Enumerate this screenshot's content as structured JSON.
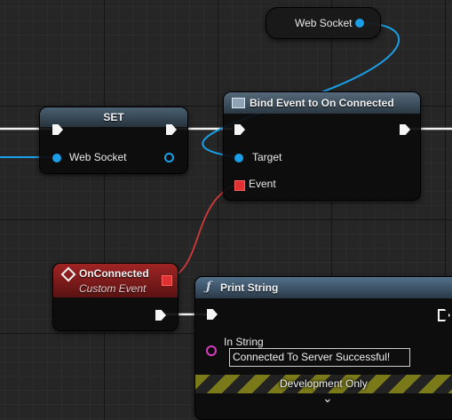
{
  "nodes": {
    "websocket_getter": {
      "label": "Web Socket"
    },
    "set_node": {
      "title": "SET",
      "pin_label": "Web Socket"
    },
    "bind_event": {
      "title": "Bind Event to On Connected",
      "target_label": "Target",
      "event_label": "Event"
    },
    "on_connected": {
      "title": "OnConnected",
      "subtitle": "Custom Event"
    },
    "print_string": {
      "title": "Print String",
      "func_glyph": "ƒ",
      "in_string_label": "In String",
      "in_string_value": "Connected To Server Successful!",
      "dev_only_label": "Development Only",
      "expand_glyph": "⌄"
    }
  },
  "colors": {
    "exec": "#f5f5f5",
    "object_pin": "#1a9fe6",
    "delegate_pin": "#e03030",
    "string_pin": "#d63bbf",
    "event_header": "#8a1c1c",
    "function_header": "#3f5f78"
  }
}
